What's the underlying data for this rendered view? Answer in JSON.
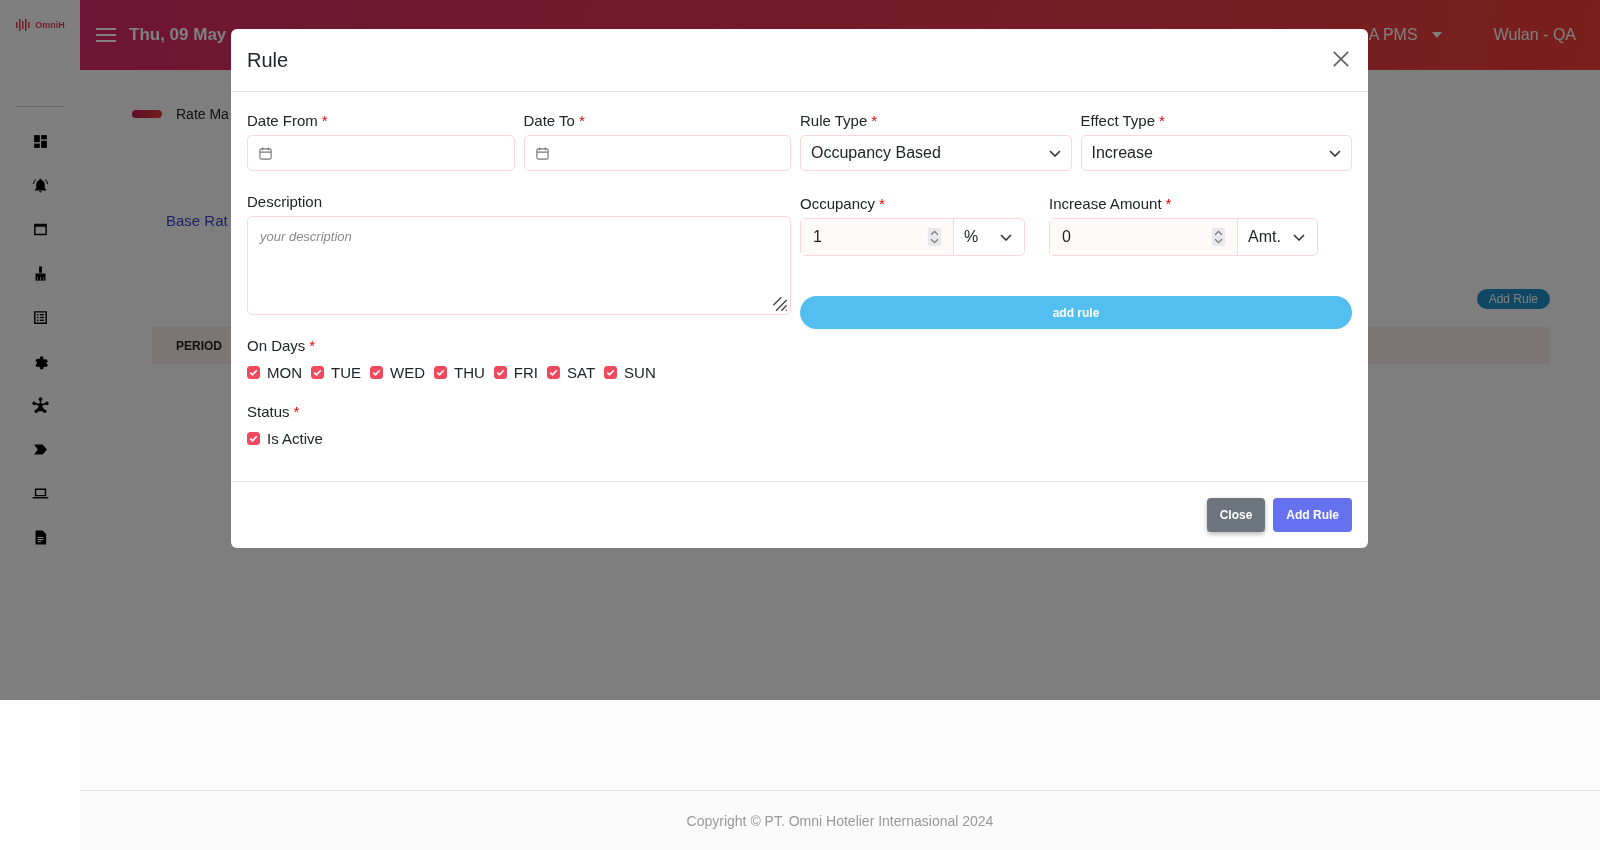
{
  "app": {
    "logo": "OmniH",
    "header": {
      "date": "Thu, 09 May",
      "property": "A PMS",
      "user": "Wulan - QA"
    }
  },
  "page": {
    "title": "Rate Ma",
    "tab": "Base Rat",
    "add_button": "Add Rule",
    "table": {
      "columns": [
        "PERIOD"
      ]
    }
  },
  "modal": {
    "title": "Rule",
    "date_from": {
      "label": "Date From",
      "mark": "*"
    },
    "date_to": {
      "label": "Date To",
      "mark": "*"
    },
    "rule_type": {
      "label": "Rule Type",
      "mark": "*",
      "value": "Occupancy Based"
    },
    "effect_type": {
      "label": "Effect Type",
      "mark": "*",
      "value": "Increase"
    },
    "description": {
      "label": "Description",
      "placeholder": "your description"
    },
    "occupancy": {
      "label": "Occupancy",
      "mark": "*",
      "value": "1",
      "unit": "%"
    },
    "amount": {
      "label": "Increase Amount",
      "mark": "*",
      "value": "0",
      "unit": "Amt."
    },
    "add_rule_inline": "add rule",
    "on_days": {
      "label": "On Days",
      "mark": "*",
      "days": [
        {
          "label": "MON",
          "checked": true
        },
        {
          "label": "TUE",
          "checked": true
        },
        {
          "label": "WED",
          "checked": true
        },
        {
          "label": "THU",
          "checked": true
        },
        {
          "label": "FRI",
          "checked": true
        },
        {
          "label": "SAT",
          "checked": true
        },
        {
          "label": "SUN",
          "checked": true
        }
      ]
    },
    "status": {
      "label": "Status",
      "mark": "*",
      "options": [
        {
          "label": "Is Active",
          "checked": true
        }
      ]
    },
    "buttons": [
      {
        "label": "Close",
        "kind": "secondary"
      },
      {
        "label": "Add Rule",
        "kind": "primary"
      }
    ]
  },
  "footer": {
    "copyright": "Copyright © PT. Omni Hotelier Internasional 2024"
  }
}
